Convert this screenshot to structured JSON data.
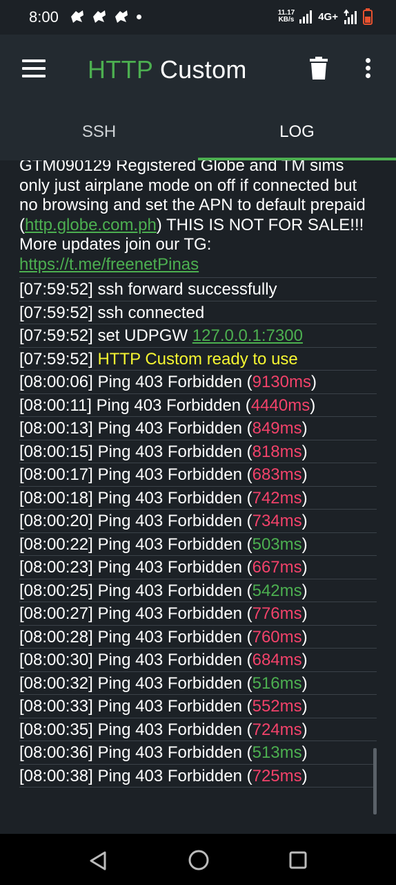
{
  "status_bar": {
    "time": "8:00",
    "speed_value": "11.17",
    "speed_unit": "KB/s",
    "network": "4G+",
    "battery_color": "#e8522f"
  },
  "toolbar": {
    "title_part1": "HTTP",
    "title_part2": "Custom",
    "icons": [
      "menu-icon",
      "delete-icon",
      "more-vert-icon"
    ]
  },
  "tabs": [
    {
      "label": "SSH",
      "active": false
    },
    {
      "label": "LOG",
      "active": true
    }
  ],
  "log": {
    "intro_text_1": "GTM090129 Registered Globe and TM sims only just airplane mode on off if connected but no browsing and set the APN to default prepaid (",
    "intro_link_1": "http.globe.com.ph",
    "intro_text_2": ") THIS IS NOT FOR SALE!!! More updates join our TG:",
    "intro_link_2": "https://t.me/freenetPinas",
    "lines": [
      {
        "ts": "[07:59:52]",
        "text": "ssh forward successfully"
      },
      {
        "ts": "[07:59:52]",
        "text": "ssh connected"
      },
      {
        "ts": "[07:59:52]",
        "text": "set UDPGW",
        "link": "127.0.0.1:7300"
      },
      {
        "ts": "[07:59:52]",
        "text": "HTTP Custom ready to use",
        "style": "ready"
      }
    ],
    "pings": [
      {
        "ts": "[08:00:06]",
        "ms": "9130ms",
        "color": "red"
      },
      {
        "ts": "[08:00:11]",
        "ms": "4440ms",
        "color": "red"
      },
      {
        "ts": "[08:00:13]",
        "ms": "849ms",
        "color": "red"
      },
      {
        "ts": "[08:00:15]",
        "ms": "818ms",
        "color": "red"
      },
      {
        "ts": "[08:00:17]",
        "ms": "683ms",
        "color": "red"
      },
      {
        "ts": "[08:00:18]",
        "ms": "742ms",
        "color": "red"
      },
      {
        "ts": "[08:00:20]",
        "ms": "734ms",
        "color": "red"
      },
      {
        "ts": "[08:00:22]",
        "ms": "503ms",
        "color": "green"
      },
      {
        "ts": "[08:00:23]",
        "ms": "667ms",
        "color": "red"
      },
      {
        "ts": "[08:00:25]",
        "ms": "542ms",
        "color": "green"
      },
      {
        "ts": "[08:00:27]",
        "ms": "776ms",
        "color": "red"
      },
      {
        "ts": "[08:00:28]",
        "ms": "760ms",
        "color": "red"
      },
      {
        "ts": "[08:00:30]",
        "ms": "684ms",
        "color": "red"
      },
      {
        "ts": "[08:00:32]",
        "ms": "516ms",
        "color": "green"
      },
      {
        "ts": "[08:00:33]",
        "ms": "552ms",
        "color": "red"
      },
      {
        "ts": "[08:00:35]",
        "ms": "724ms",
        "color": "red"
      },
      {
        "ts": "[08:00:36]",
        "ms": "513ms",
        "color": "green"
      },
      {
        "ts": "[08:00:38]",
        "ms": "725ms",
        "color": "red"
      }
    ],
    "ping_label": "Ping 403 Forbidden",
    "colors": {
      "red": "#f2426a",
      "green": "#4caf50",
      "ready": "#f5f531"
    }
  },
  "nav_bar": {
    "icons": [
      "back-icon",
      "home-icon",
      "recent-apps-icon"
    ]
  }
}
